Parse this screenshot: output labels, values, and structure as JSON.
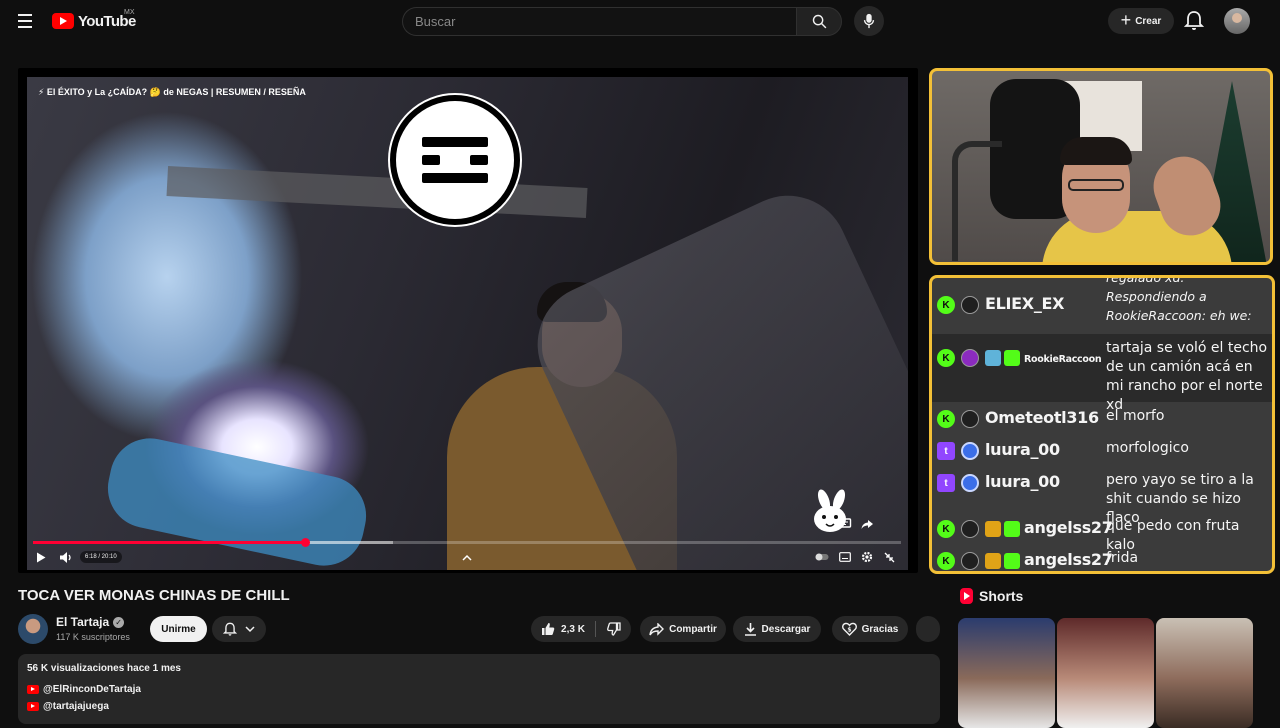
{
  "header": {
    "logo_text": "YouTube",
    "country": "MX",
    "search_placeholder": "Buscar",
    "create_label": "Crear"
  },
  "player": {
    "overlay_title": "⚡ El ÉXITO y La ¿CAÍDA? 🤔 de NEGAS | RESUMEN / RESEÑA",
    "time": "6:18 / 20:10",
    "progress_fraction": 0.313,
    "buffer_fraction": 0.415
  },
  "chat": {
    "messages": [
      {
        "platform": "kick",
        "user": "ELIEX_EX",
        "reply_prefix": "regalado xd:",
        "text": "Respondiendo a RookieRaccoon: eh we:",
        "italic": true
      },
      {
        "platform": "kick",
        "user": "RookieRaccoon",
        "text": "tartaja se voló el techo de un camión acá en mi rancho por el norte xd",
        "highlight": true
      },
      {
        "platform": "kick",
        "user": "Ometeotl316",
        "text": "el morfo"
      },
      {
        "platform": "twitch",
        "user": "luura_00",
        "text": "morfologico"
      },
      {
        "platform": "twitch",
        "user": "luura_00",
        "text": "pero yayo se tiro a la shit cuando se hizo flaco"
      },
      {
        "platform": "kick",
        "user": "angelss27",
        "text": "que pedo con fruta kalo"
      },
      {
        "platform": "kick",
        "user": "angelss27",
        "text": "frida"
      }
    ],
    "platform_glyphs": {
      "kick": "K",
      "twitch": "t"
    }
  },
  "video": {
    "title": "TOCA VER MONAS CHINAS DE CHILL",
    "channel_name": "El Tartaja",
    "subscribers": "117 K suscriptores",
    "join_label": "Unirme",
    "likes": "2,3 K",
    "share_label": "Compartir",
    "download_label": "Descargar",
    "thanks_label": "Gracias"
  },
  "description": {
    "meta": "56 K visualizaciones  hace 1 mes",
    "links": [
      "@ElRinconDeTartaja",
      "@tartajajuega"
    ]
  },
  "shorts": {
    "heading": "Shorts"
  },
  "colors": {
    "accent_red": "#ff0033",
    "overlay_border": "#f3c037",
    "kick_green": "#53fc18",
    "twitch_purple": "#9146ff"
  }
}
